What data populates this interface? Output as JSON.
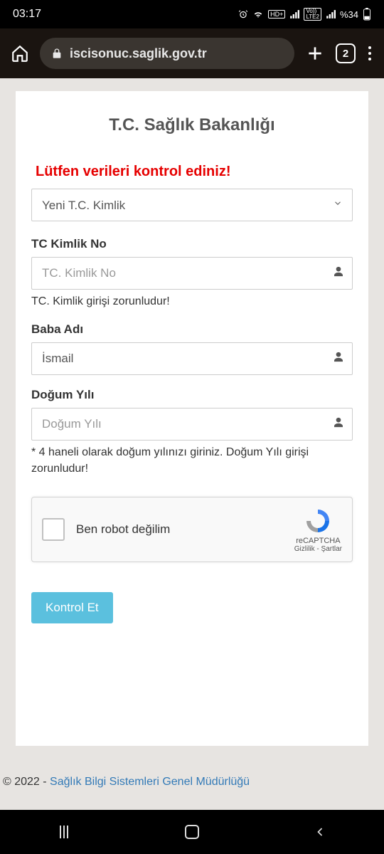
{
  "status": {
    "time": "03:17",
    "battery_text": "%34",
    "indicators": [
      "alarm",
      "wifi",
      "hd-plus",
      "signal-1",
      "volte2",
      "signal-2"
    ]
  },
  "browser": {
    "url": "iscisonuc.saglik.gov.tr",
    "tab_count": "2"
  },
  "page": {
    "title": "T.C. Sağlık Bakanlığı",
    "error": "Lütfen verileri kontrol ediniz!",
    "select": {
      "value": "Yeni T.C. Kimlik"
    },
    "fields": {
      "tc": {
        "label": "TC Kimlik No",
        "placeholder": "TC. Kimlik No",
        "value": "",
        "help": "TC. Kimlik girişi zorunludur!"
      },
      "baba": {
        "label": "Baba Adı",
        "placeholder": "",
        "value": "İsmail"
      },
      "yil": {
        "label": "Doğum Yılı",
        "placeholder": "Doğum Yılı",
        "value": "",
        "help": "* 4 haneli olarak doğum yılınızı giriniz. Doğum Yılı girişi zorunludur!"
      }
    },
    "recaptcha": {
      "label": "Ben robot değilim",
      "brand": "reCAPTCHA",
      "privacy": "Gizlilik",
      "terms": "Şartlar"
    },
    "submit": "Kontrol Et",
    "footer": {
      "copyright": "© 2022 - ",
      "link": "Sağlık Bilgi Sistemleri Genel Müdürlüğü"
    }
  }
}
